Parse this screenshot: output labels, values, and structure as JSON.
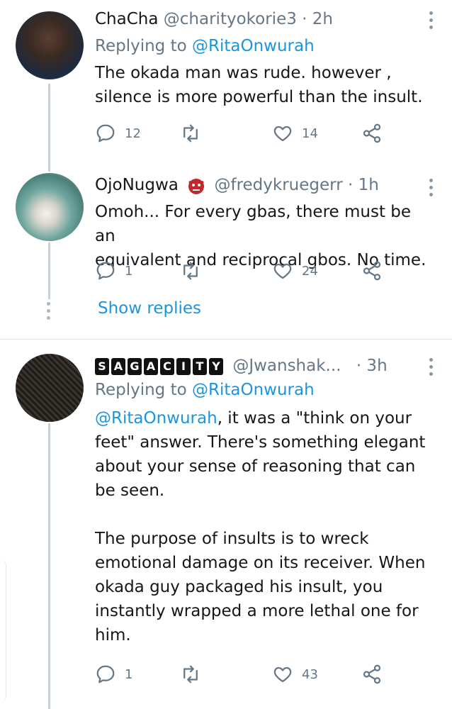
{
  "tweets": [
    {
      "name": "ChaCha",
      "handle": "@charityokorie3",
      "time": "· 2h",
      "replying_prefix": "Replying to",
      "replying_to": "@RitaOnwurah",
      "text_lines": [
        "The okada man was rude. however ,",
        "silence is more powerful than the insult."
      ],
      "replies": "12",
      "retweets": "",
      "likes": "14",
      "avatar_colors": [
        "#3a2a22",
        "#2f4f7a"
      ]
    },
    {
      "name": "OjoNugwa",
      "emoji": "ogre-emoji",
      "handle": "@fredykruegerr",
      "time": "· 1h",
      "text_lines": [
        "Omoh... For every gbas, there must be an",
        "equivalent and reciprocal gbos. No time."
      ],
      "replies": "1",
      "retweets": "",
      "likes": "24",
      "avatar_colors": [
        "#6fa7a0",
        "#c9b48a"
      ]
    },
    {
      "badge_letters": [
        "S",
        "A",
        "G",
        "A",
        "C",
        "I",
        "T",
        "Y"
      ],
      "handle": "@Jwanshak...",
      "time": "· 3h",
      "replying_prefix": "Replying to",
      "replying_to": "@RitaOnwurah",
      "mention": "@RitaOnwurah",
      "text_first_rest": ", it was a \"think on your",
      "text_lines": [
        "feet\" answer. There's something elegant",
        "about your sense of reasoning that can",
        "be seen."
      ],
      "text_lines2": [
        "The purpose of insults is to wreck",
        "emotional damage on its receiver. When",
        "okada guy packaged his insult, you",
        "instantly wrapped a more lethal one for",
        "him."
      ],
      "replies": "1",
      "retweets": "",
      "likes": "43",
      "avatar_colors": [
        "#5a544e",
        "#8a857f"
      ]
    }
  ],
  "show_replies": "Show replies",
  "colors": {
    "accent": "#1b95e0",
    "muted": "#657786",
    "divider": "#e1e8ed"
  }
}
